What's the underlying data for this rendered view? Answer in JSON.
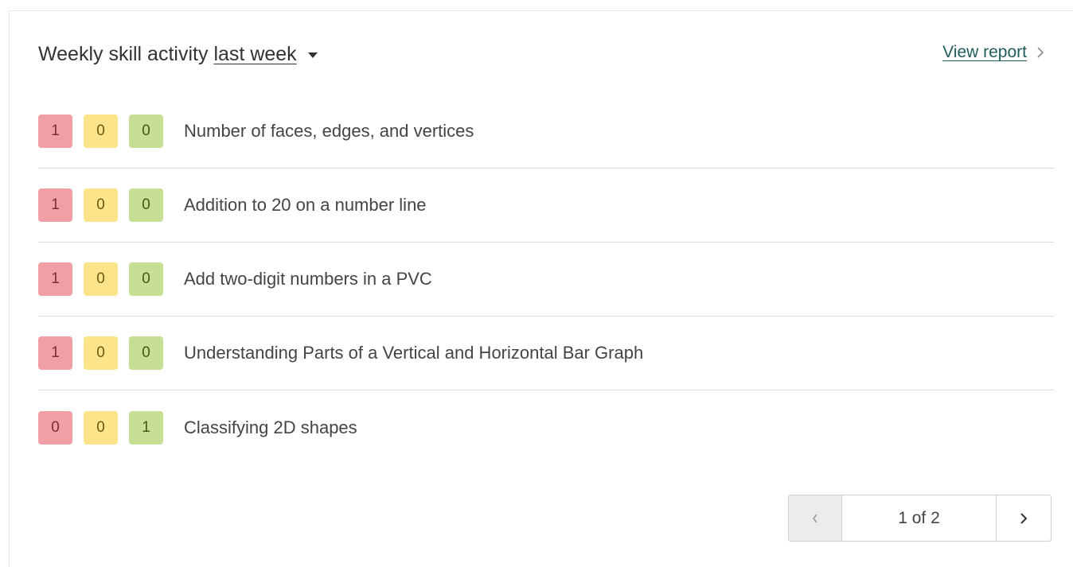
{
  "header": {
    "title": "Weekly skill activity",
    "period": "last week",
    "view_report": "View report"
  },
  "colors": {
    "red": "#f0a0a5",
    "yellow": "#fbe48a",
    "green": "#c6df95",
    "link": "#1f5d5a"
  },
  "skills": [
    {
      "red": "1",
      "yellow": "0",
      "green": "0",
      "name": "Number of faces, edges, and vertices"
    },
    {
      "red": "1",
      "yellow": "0",
      "green": "0",
      "name": "Addition to 20 on a number line"
    },
    {
      "red": "1",
      "yellow": "0",
      "green": "0",
      "name": "Add two-digit numbers in a PVC"
    },
    {
      "red": "1",
      "yellow": "0",
      "green": "0",
      "name": "Understanding Parts of a Vertical and Horizontal Bar Graph"
    },
    {
      "red": "0",
      "yellow": "0",
      "green": "1",
      "name": "Classifying 2D shapes"
    }
  ],
  "pagination": {
    "label": "1 of 2",
    "prev_icon": "chevron-left-icon",
    "next_icon": "chevron-right-icon"
  }
}
